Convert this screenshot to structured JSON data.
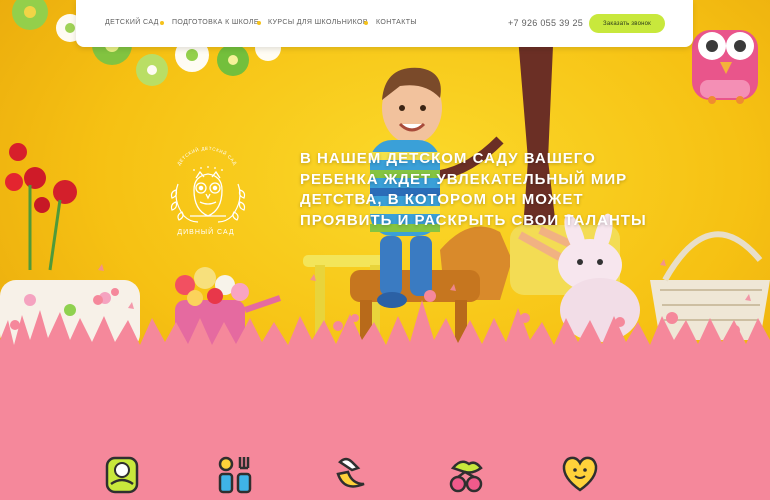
{
  "nav": {
    "items": [
      {
        "label": "ДЕТСКИЙ САД"
      },
      {
        "label": "ПОДГОТОВКА К ШКОЛЕ"
      },
      {
        "label": "КУРСЫ ДЛЯ ШКОЛЬНИКОВ"
      },
      {
        "label": "КОНТАКТЫ"
      }
    ],
    "phone": "+7 926 055 39 25",
    "cta_label": "Заказать звонок"
  },
  "logo": {
    "top_text": "ДЕТСКИЙ ДЕТСКИЙ САД",
    "name": "ДИВНЫЙ САД"
  },
  "hero": {
    "title": "В НАШЕМ ДЕТСКОМ САДУ ВАШЕГО РЕБЕНКА ЖДЕТ УВЛЕКАТЕЛЬНЫЙ МИР ДЕТСТВА, В КОТОРОМ ОН МОЖЕТ ПРОЯВИТЬ И РАСКРЫТЬ СВОИ ТАЛАНТЫ"
  },
  "features": [
    {
      "icon": "baby-icon"
    },
    {
      "icon": "utensils-icon"
    },
    {
      "icon": "moon-icon"
    },
    {
      "icon": "toy-icon"
    },
    {
      "icon": "heart-icon"
    }
  ],
  "colors": {
    "background_yellow": "#f7c515",
    "pink": "#f5889b",
    "button_green": "#c8e83c",
    "nav_dot": "#f5c21b"
  }
}
